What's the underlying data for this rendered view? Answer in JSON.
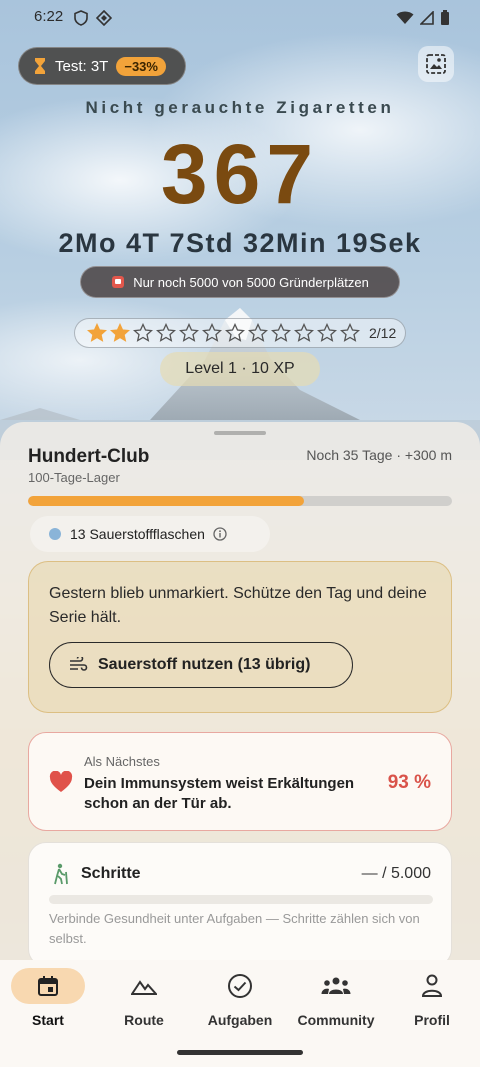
{
  "status": {
    "time": "6:22"
  },
  "header": {
    "test_label": "Test: 3T",
    "test_badge": "−33%",
    "headline": "Nicht gerauchte Zigaretten",
    "count": "367",
    "duration": "2Mo 4T 7Std 32Min 19Sek",
    "founder_text": "Nur noch 5000 von 5000 Gründerplätzen",
    "stars_filled": 2,
    "stars_total": 12,
    "stars_label": "2/12",
    "level_text": "Level 1 · 10 XP"
  },
  "goal": {
    "title": "Hundert-Club",
    "subtitle": "100-Tage-Lager",
    "right_text": "Noch 35 Tage · +300 m",
    "progress": 0.65
  },
  "oxygen": {
    "label": "13 Sauerstoffflaschen"
  },
  "warning": {
    "message": "Gestern blieb unmarkiert. Schütze den Tag und deine Serie hält.",
    "button_label": "Sauerstoff nutzen (13 übrig)"
  },
  "next": {
    "label": "Als Nächstes",
    "text": "Dein Immunsystem weist Erkältungen schon an der Tür ab.",
    "percent": "93 %"
  },
  "steps": {
    "title": "Schritte",
    "value": "— / 5.000",
    "hint": "Verbinde Gesundheit unter Aufgaben — Schritte zählen sich von selbst."
  },
  "nav": {
    "items": [
      {
        "label": "Start",
        "icon": "calendar-icon",
        "active": true
      },
      {
        "label": "Route",
        "icon": "mountain-icon",
        "active": false
      },
      {
        "label": "Aufgaben",
        "icon": "check-circle-icon",
        "active": false
      },
      {
        "label": "Community",
        "icon": "group-icon",
        "active": false
      },
      {
        "label": "Profil",
        "icon": "person-icon",
        "active": false
      }
    ]
  },
  "colors": {
    "accent": "#f2a33a",
    "count": "#7a4a10",
    "heart": "#d9534a"
  }
}
